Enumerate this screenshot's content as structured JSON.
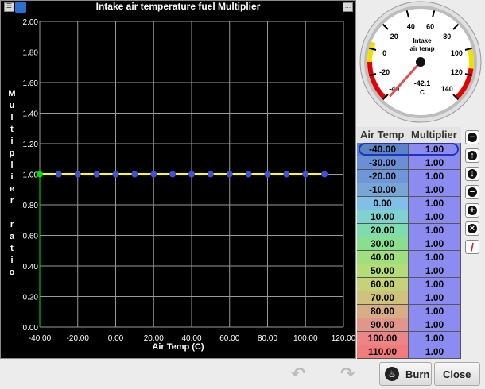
{
  "chart": {
    "title": "Intake air temperature fuel Multiplier",
    "y_axis_label": "Multiplier ratio",
    "x_axis_label": "Air Temp (C)"
  },
  "chart_data": {
    "type": "line",
    "title": "Intake air temperature fuel Multiplier",
    "xlabel": "Air Temp (C)",
    "ylabel": "Multiplier ratio",
    "xlim": [
      -40,
      120
    ],
    "ylim": [
      0,
      2
    ],
    "x_ticks": [
      "-40.00",
      "-20.00",
      "0.00",
      "20.00",
      "40.00",
      "60.00",
      "80.00",
      "100.00",
      "120.00"
    ],
    "y_ticks": [
      "0.00",
      "0.20",
      "0.40",
      "0.60",
      "0.80",
      "1.00",
      "1.20",
      "1.40",
      "1.60",
      "1.80",
      "2.00"
    ],
    "x": [
      -40,
      -30,
      -20,
      -10,
      0,
      10,
      20,
      30,
      40,
      50,
      60,
      70,
      80,
      90,
      100,
      110
    ],
    "y": [
      1,
      1,
      1,
      1,
      1,
      1,
      1,
      1,
      1,
      1,
      1,
      1,
      1,
      1,
      1,
      1
    ],
    "grid": true,
    "series_color": "#ffff00",
    "point_color": "#3f4fe0",
    "selected_point_color": "#00e000"
  },
  "gauge": {
    "title_line1": "Intake",
    "title_line2": "air temp",
    "value": "-42.1",
    "unit": "C",
    "ticks": [
      "-40",
      "-20",
      "0",
      "20",
      "40",
      "60",
      "80",
      "100",
      "120",
      "140"
    ],
    "needle_value": -42.1
  },
  "table": {
    "col1": "Air Temp",
    "col2": "Multiplier",
    "rows": [
      {
        "temp": "-40.00",
        "mult": "1.00",
        "color": "#5b83c7"
      },
      {
        "temp": "-30.00",
        "mult": "1.00",
        "color": "#6a8fd6"
      },
      {
        "temp": "-20.00",
        "mult": "1.00",
        "color": "#6f97d8"
      },
      {
        "temp": "-10.00",
        "mult": "1.00",
        "color": "#78a6d6"
      },
      {
        "temp": "0.00",
        "mult": "1.00",
        "color": "#80bfe6"
      },
      {
        "temp": "10.00",
        "mult": "1.00",
        "color": "#7fd3cf"
      },
      {
        "temp": "20.00",
        "mult": "1.00",
        "color": "#7fdcae"
      },
      {
        "temp": "30.00",
        "mult": "1.00",
        "color": "#88e08f"
      },
      {
        "temp": "40.00",
        "mult": "1.00",
        "color": "#9ee07e"
      },
      {
        "temp": "50.00",
        "mult": "1.00",
        "color": "#b4dd78"
      },
      {
        "temp": "60.00",
        "mult": "1.00",
        "color": "#c6d277"
      },
      {
        "temp": "70.00",
        "mult": "1.00",
        "color": "#cfc27c"
      },
      {
        "temp": "80.00",
        "mult": "1.00",
        "color": "#d6ad85"
      },
      {
        "temp": "90.00",
        "mult": "1.00",
        "color": "#e0968a"
      },
      {
        "temp": "100.00",
        "mult": "1.00",
        "color": "#eb8588"
      },
      {
        "temp": "110.00",
        "mult": "1.00",
        "color": "#f37b7b"
      }
    ],
    "mult_color": "#8b8bf0"
  },
  "side_buttons": [
    {
      "name": "collapse-icon",
      "glyph": "−"
    },
    {
      "name": "up-arrow-icon",
      "glyph": "↑"
    },
    {
      "name": "down-arrow-icon",
      "glyph": "↓"
    },
    {
      "name": "minus-icon",
      "glyph": "−"
    },
    {
      "name": "plus-icon",
      "glyph": "+"
    },
    {
      "name": "clear-icon",
      "glyph": "×"
    },
    {
      "name": "pencil-icon",
      "glyph": "/"
    }
  ],
  "footer": {
    "burn_label": "Burn",
    "close_label": "Close"
  }
}
